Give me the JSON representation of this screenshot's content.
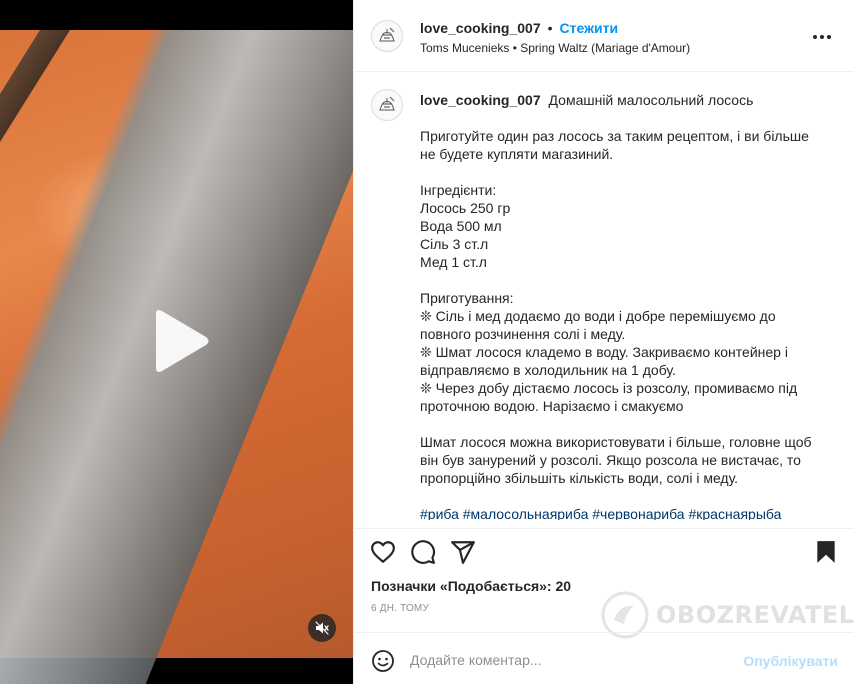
{
  "post": {
    "username": "love_cooking_007",
    "follow_label": "Стежити",
    "separator": "•",
    "music": "Toms Mucenieks • Spring Waltz (Mariage d'Amour)"
  },
  "caption": {
    "title": "Домашній малосольний лосось",
    "intro": "Приготуйте один раз лосось за таким рецептом, і ви більше не будете купляти магазиний.",
    "ingredients": "Інгредієнти:\n Лосось 250 гр\n Вода 500 мл\n Сіль 3 ст.л\n Мед 1 ст.л",
    "steps": "Приготування:\n❊ Сіль і мед додаємо до води і добре перемішуємо до повного розчинення солі і меду.\n❊ Шмат лосося кладемо в воду. Закриваємо контейнер і відправляємо в холодильник на 1 добу.\n❊ Через добу дістаємо лосось із розсолу, промиваємо під проточною водою. Нарізаємо і смакуємо",
    "note": "Шмат лосося можна використовувати і більше, головне щоб він був занурений у розсолі. Якщо розсола не вистачає, то пропорційно збільшіть кількість води, солі і меду.",
    "hashtags": "#риба #малосольнаяриба #червонариба #краснаярыба"
  },
  "engagement": {
    "likes_text": "Позначки «Подобається»: 20",
    "time_ago": "6 дн. тому"
  },
  "comment": {
    "placeholder": "Додайте коментар...",
    "publish_label": "Опублікувати"
  },
  "watermark": {
    "text": "OBOZREVATEL"
  },
  "icons": [
    "play-icon",
    "mute-icon",
    "more-icon",
    "heart-icon",
    "comment-icon",
    "share-icon",
    "bookmark-icon",
    "emoji-icon"
  ]
}
